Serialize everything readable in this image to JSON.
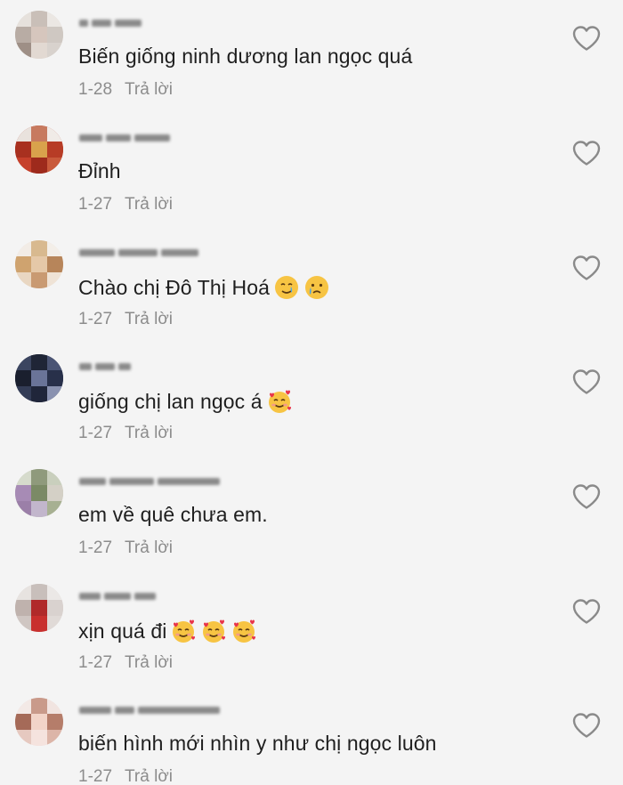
{
  "colors": {
    "background": "#f4f4f4",
    "comment_text": "#1f1f1f",
    "meta_text": "#8c8c8c",
    "heart_stroke": "#8a8a8a"
  },
  "comments": [
    {
      "username_obscured": true,
      "text": "Biến giống ninh dương lan ngọc quá",
      "emojis": [],
      "date": "1-28",
      "reply_label": "Trả lời",
      "like_icon": "heart-outline-icon"
    },
    {
      "username_obscured": true,
      "text": "Đỉnh",
      "emojis": [],
      "date": "1-27",
      "reply_label": "Trả lời",
      "like_icon": "heart-outline-icon"
    },
    {
      "username_obscured": true,
      "text": "Chào chị Đô Thị Hoá",
      "emojis": [
        "crying-smiling-face-emoji",
        "crying-face-emoji"
      ],
      "date": "1-27",
      "reply_label": "Trả lời",
      "like_icon": "heart-outline-icon"
    },
    {
      "username_obscured": true,
      "text": "giống chị lan ngọc á",
      "emojis": [
        "smiling-face-with-hearts-emoji"
      ],
      "date": "1-27",
      "reply_label": "Trả lời",
      "like_icon": "heart-outline-icon"
    },
    {
      "username_obscured": true,
      "text": "em về quê chưa em.",
      "emojis": [],
      "date": "1-27",
      "reply_label": "Trả lời",
      "like_icon": "heart-outline-icon"
    },
    {
      "username_obscured": true,
      "text": "xịn quá đi",
      "emojis": [
        "smiling-face-with-hearts-emoji",
        "smiling-face-with-hearts-emoji",
        "smiling-face-with-hearts-emoji"
      ],
      "date": "1-27",
      "reply_label": "Trả lời",
      "like_icon": "heart-outline-icon"
    },
    {
      "username_obscured": true,
      "text": "biến hình mới nhìn y như chị ngọc luôn",
      "emojis": [],
      "date": "1-27",
      "reply_label": "Trả lời",
      "like_icon": "heart-outline-icon"
    }
  ]
}
